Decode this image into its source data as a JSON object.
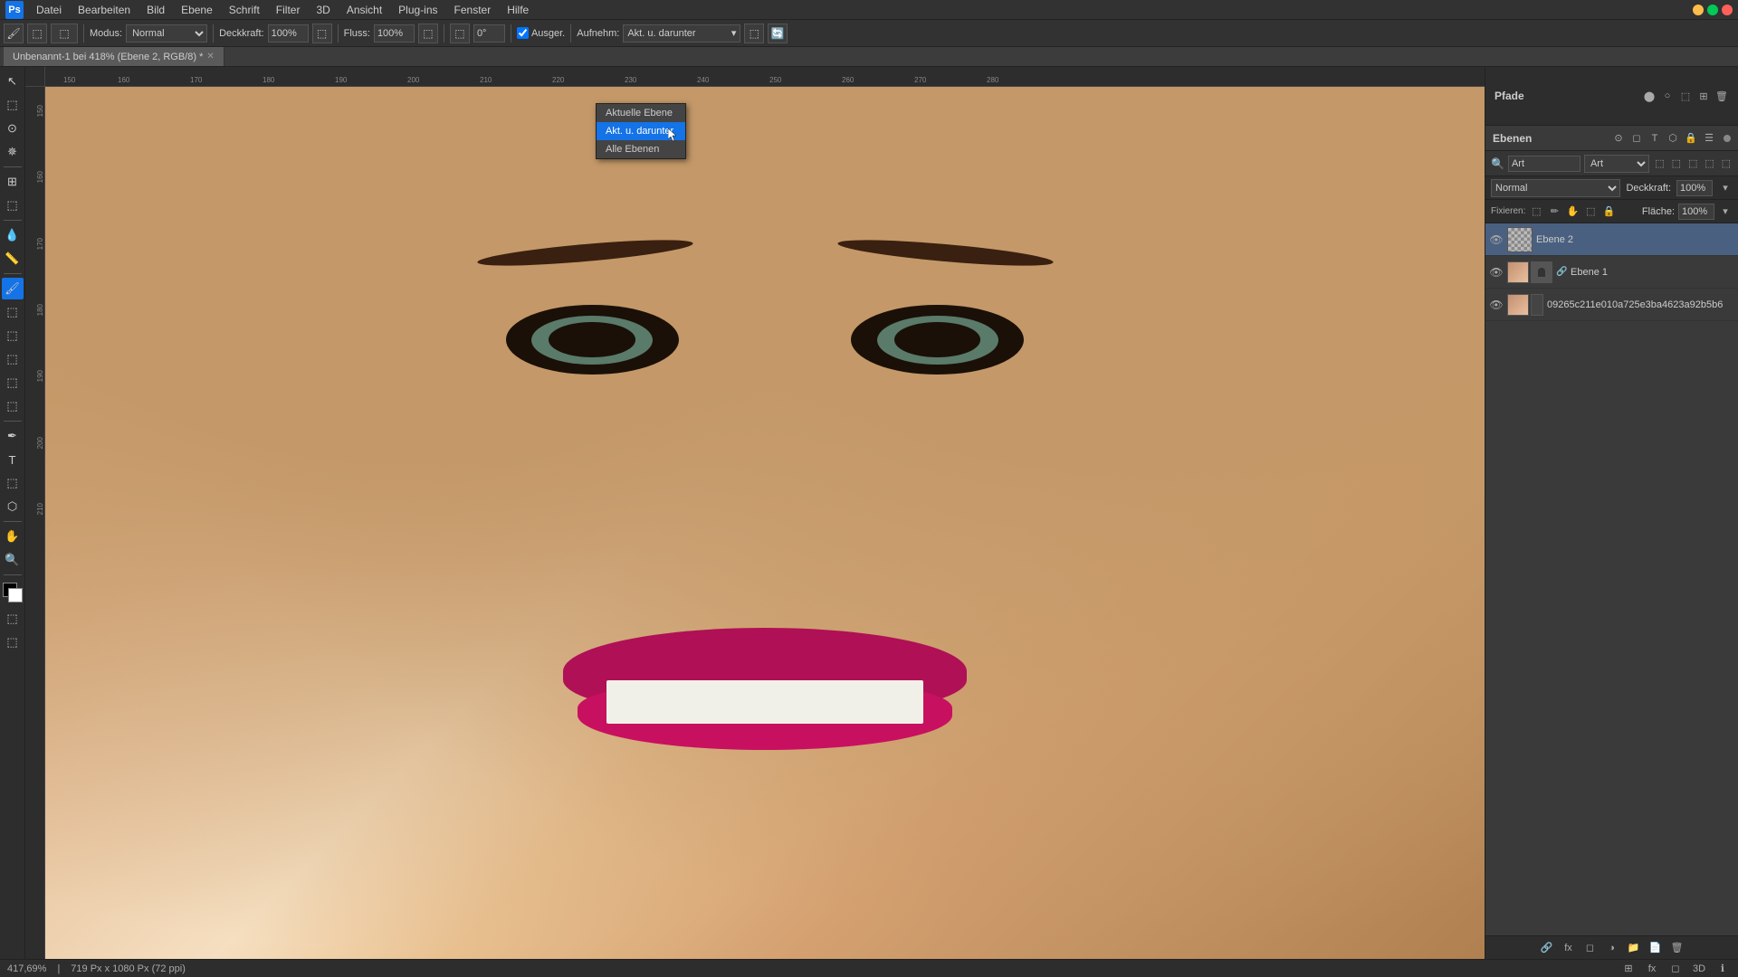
{
  "app": {
    "name": "Photoshop",
    "icon_label": "Ps",
    "window_title": "Unbenannt-1 bei 418% (Ebene 2, RGB/8) *"
  },
  "menu": {
    "items": [
      "Datei",
      "Bearbeiten",
      "Bild",
      "Ebene",
      "Schrift",
      "Filter",
      "3D",
      "Ansicht",
      "Plug-ins",
      "Fenster",
      "Hilfe"
    ]
  },
  "toolbar": {
    "modus_label": "Modus:",
    "modus_value": "Normal",
    "deckkraft_label": "Deckkraft:",
    "deckkraft_value": "100%",
    "fluss_label": "Fluss:",
    "fluss_value": "100%",
    "ausger_label": "Ausger.",
    "aufnehm_label": "Aufnehm:",
    "sample_label": "Akt. u. darunter",
    "sample_options": [
      "Aktuelle Ebene",
      "Akt. u. darunter",
      "Alle Ebenen"
    ]
  },
  "tabs": {
    "active_tab": "Unbenannt-1 bei 418% (Ebene 2, RGB/8) *"
  },
  "layers_panel": {
    "title": "Ebenen",
    "paths_title": "Pfade",
    "search_placeholder": "Art",
    "blend_mode": "Normal",
    "deckkraft_label": "Deckkraft:",
    "deckkraft_value": "100%",
    "fläche_label": "Fläche:",
    "fläche_value": "100%",
    "layers": [
      {
        "id": "ebene2",
        "name": "Ebene 2",
        "visible": true,
        "active": true
      },
      {
        "id": "ebene1",
        "name": "Ebene 1",
        "visible": true,
        "active": false
      },
      {
        "id": "bg",
        "name": "09265c211e010a725e3ba4623a92b5b6",
        "visible": true,
        "active": false
      }
    ]
  },
  "dropdown": {
    "title": "Akt. u. darunter",
    "items": [
      {
        "label": "Aktuelle Ebene",
        "selected": false
      },
      {
        "label": "Akt. u. darunter",
        "selected": true
      },
      {
        "label": "Alle Ebenen",
        "selected": false
      }
    ]
  },
  "status_bar": {
    "zoom": "417,69%",
    "dimensions": "719 Px x 1080 Px (72 ppi)"
  },
  "tools": {
    "items": [
      "↖",
      "⬚",
      "⊙",
      "✂",
      "⬚",
      "⬚",
      "✏",
      "⬚",
      "⬚",
      "✏",
      "⬚",
      "⬚",
      "⬚",
      "⬚",
      "T",
      "⬚",
      "⬚",
      "⬚",
      "⬚",
      "⬚"
    ]
  }
}
